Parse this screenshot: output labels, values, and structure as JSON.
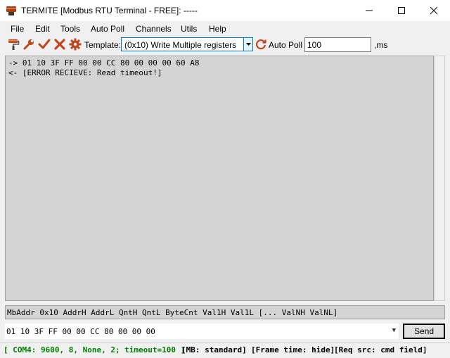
{
  "window": {
    "title": "TERMITE [Modbus RTU Terminal - FREE]: -----"
  },
  "menu": {
    "items": [
      "File",
      "Edit",
      "Tools",
      "Auto Poll",
      "Channels",
      "Utils",
      "Help"
    ]
  },
  "toolbar": {
    "template_label": "Template:",
    "template_value": "(0x10) Write Multiple registers",
    "auto_poll_label": "Auto Poll",
    "auto_poll_interval": "100",
    "ms_label": ",ms"
  },
  "terminal": {
    "lines": [
      "-> 01 10 3F FF 00 00 CC 80 00 00 00 60 A8",
      "<- [ERROR RECIEVE: Read timeout!]"
    ]
  },
  "frame_hint": "MbAddr 0x10 AddrH AddrL QntH QntL ByteCnt Val1H Val1L [... ValNH ValNL]",
  "command": {
    "value": "01 10 3F FF 00 00 CC 80 00 00 00",
    "send_label": "Send"
  },
  "status": {
    "port": "[ COM4: 9600, 8, None, 2; timeout=100 ]",
    "mb": "[MB: standard]",
    "frame_time": "[Frame time: hide]",
    "req_src": "[Req src: cmd field]",
    "port_color": "#008000"
  }
}
